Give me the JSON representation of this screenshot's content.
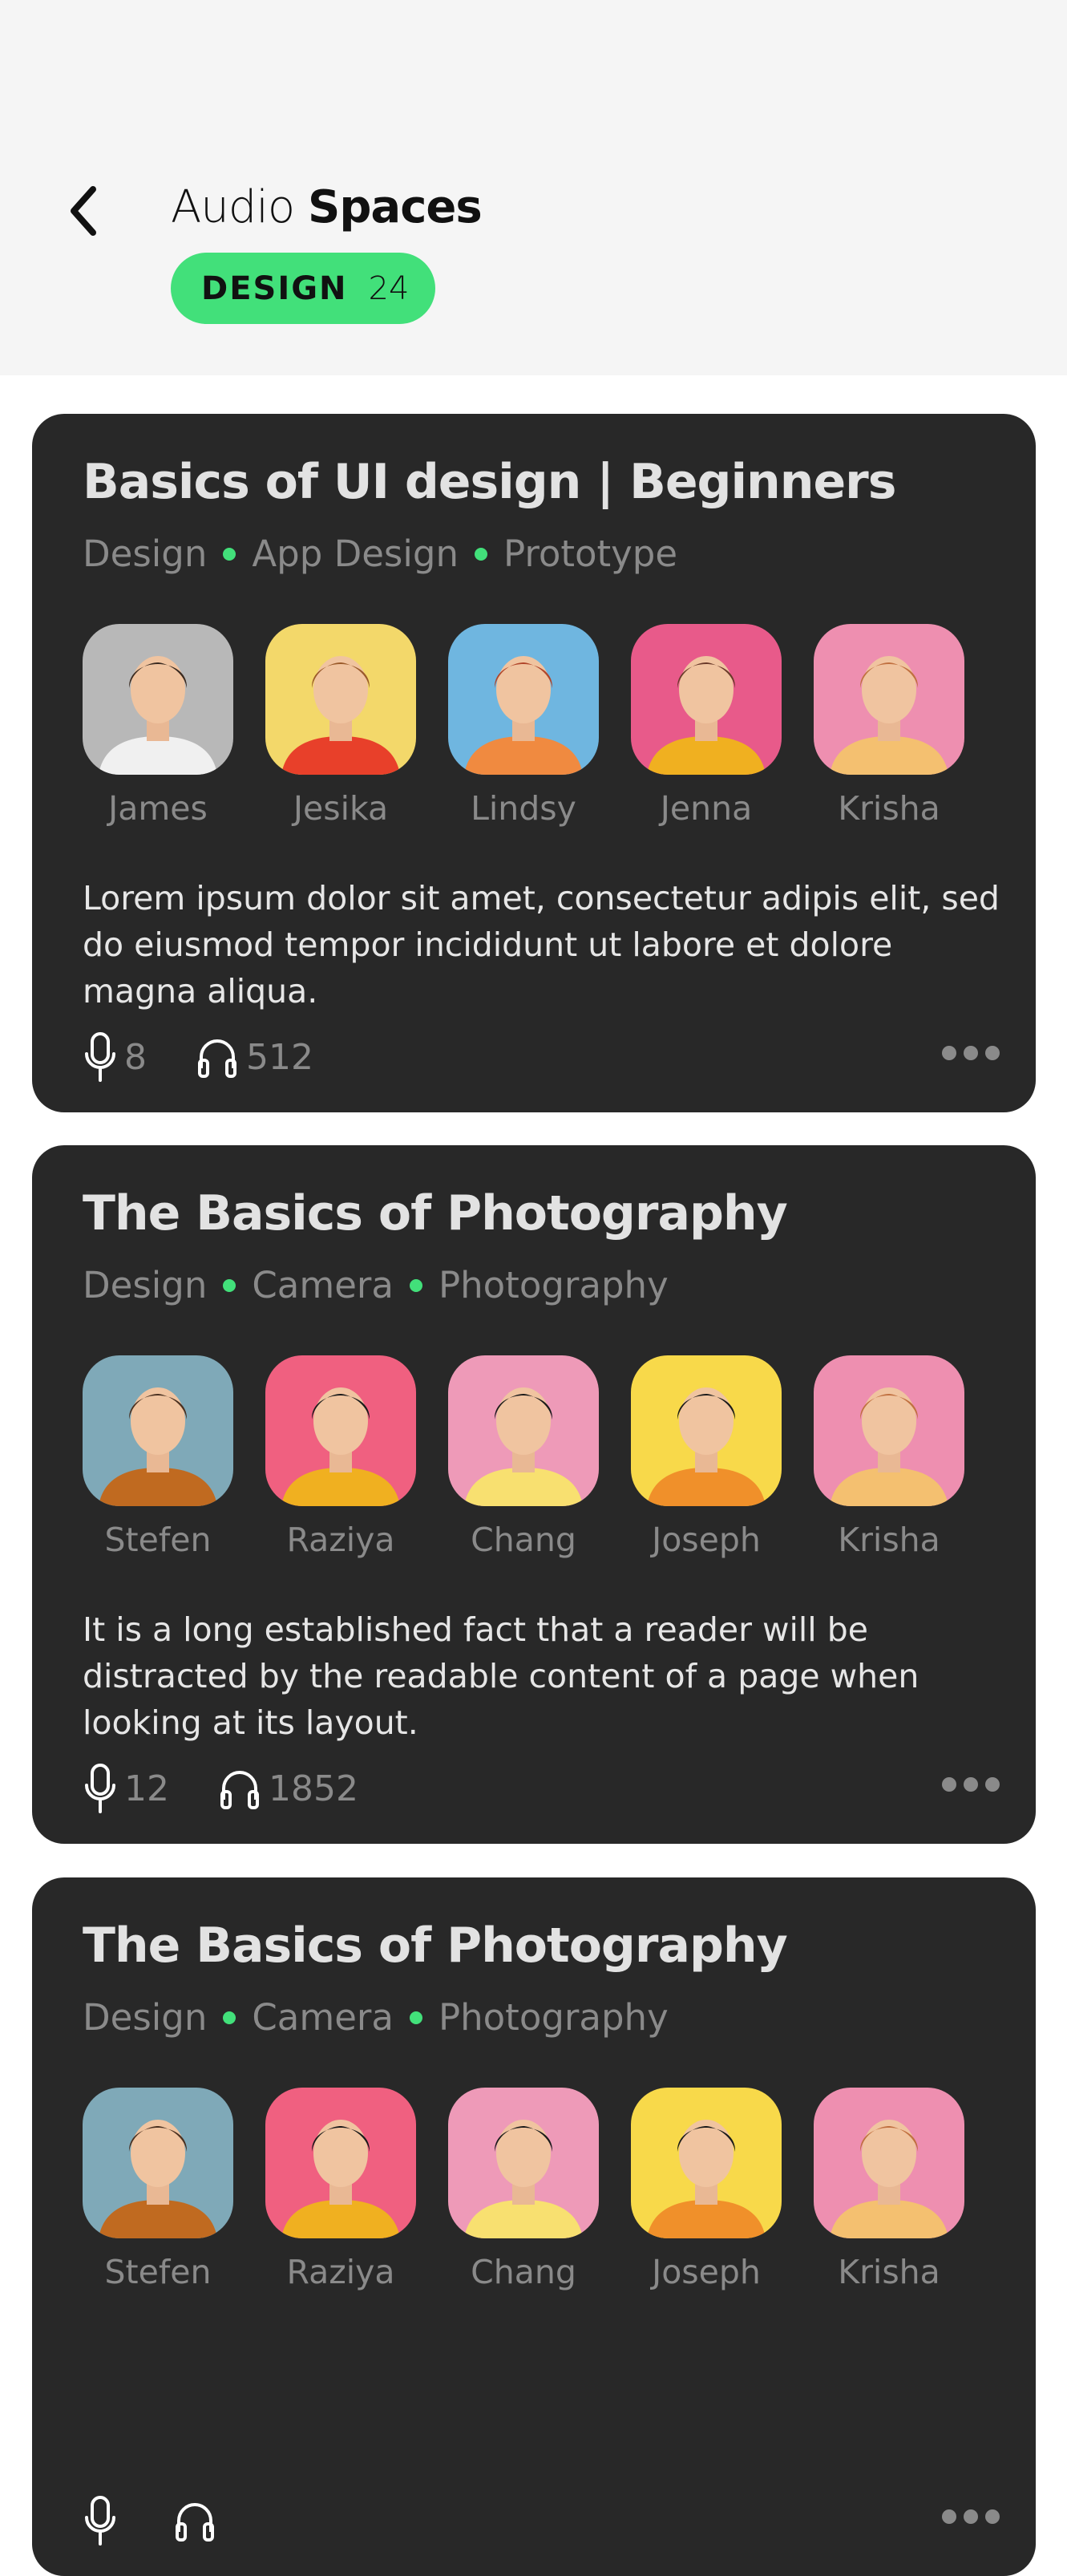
{
  "header": {
    "title_light": "Audio",
    "title_bold": "Spaces",
    "badge": {
      "label": "DESIGN",
      "count": "24"
    }
  },
  "colors": {
    "accent": "#42e07a",
    "card": "#282828",
    "header_bg": "#f5f5f5"
  },
  "cards": [
    {
      "title": "Basics of UI design | Beginners",
      "tags": [
        "Design",
        "App Design",
        "Prototype"
      ],
      "speakers": [
        {
          "name": "James",
          "bg": "#b8b8b8",
          "shirt": "#f0f0f0",
          "hair": "#3a2a20"
        },
        {
          "name": "Jesika",
          "bg": "#f3d86a",
          "shirt": "#e8402a",
          "hair": "#9a5a2a"
        },
        {
          "name": "Lindsy",
          "bg": "#6fb6e0",
          "shirt": "#f08a40",
          "hair": "#b0452a"
        },
        {
          "name": "Jenna",
          "bg": "#e85a8a",
          "shirt": "#f0b020",
          "hair": "#6a3a2a"
        },
        {
          "name": "Krisha",
          "bg": "#ee8fb0",
          "shirt": "#f4c070",
          "hair": "#c07040"
        }
      ],
      "description": "Lorem ipsum dolor sit amet, consectetur adipis elit, sed do eiusmod tempor incididunt ut labore et dolore magna aliqua.",
      "speakers_count": "8",
      "listeners_count": "512"
    },
    {
      "title": "The Basics of Photography",
      "tags": [
        "Design",
        "Camera",
        "Photography"
      ],
      "speakers": [
        {
          "name": "Stefen",
          "bg": "#7fa9b8",
          "shirt": "#c06a20",
          "hair": "#4a3020"
        },
        {
          "name": "Raziya",
          "bg": "#f06080",
          "shirt": "#f0b020",
          "hair": "#1a1a1a"
        },
        {
          "name": "Chang",
          "bg": "#ee9ab8",
          "shirt": "#f8e070",
          "hair": "#1a1a1a"
        },
        {
          "name": "Joseph",
          "bg": "#f8d94a",
          "shirt": "#f0902a",
          "hair": "#1a1a1a"
        },
        {
          "name": "Krisha",
          "bg": "#ee8fb0",
          "shirt": "#f4c070",
          "hair": "#c07040"
        }
      ],
      "description": "It is a long established fact that a reader will be distracted by the readable content of a page when looking at its layout.",
      "speakers_count": "12",
      "listeners_count": "1852"
    },
    {
      "title": "The Basics of Photography",
      "tags": [
        "Design",
        "Camera",
        "Photography"
      ],
      "speakers": [
        {
          "name": "Stefen",
          "bg": "#7fa9b8",
          "shirt": "#c06a20",
          "hair": "#4a3020"
        },
        {
          "name": "Raziya",
          "bg": "#f06080",
          "shirt": "#f0b020",
          "hair": "#1a1a1a"
        },
        {
          "name": "Chang",
          "bg": "#ee9ab8",
          "shirt": "#f8e070",
          "hair": "#1a1a1a"
        },
        {
          "name": "Joseph",
          "bg": "#f8d94a",
          "shirt": "#f0902a",
          "hair": "#1a1a1a"
        },
        {
          "name": "Krisha",
          "bg": "#ee8fb0",
          "shirt": "#f4c070",
          "hair": "#c07040"
        }
      ],
      "description": "",
      "speakers_count": "",
      "listeners_count": ""
    }
  ]
}
